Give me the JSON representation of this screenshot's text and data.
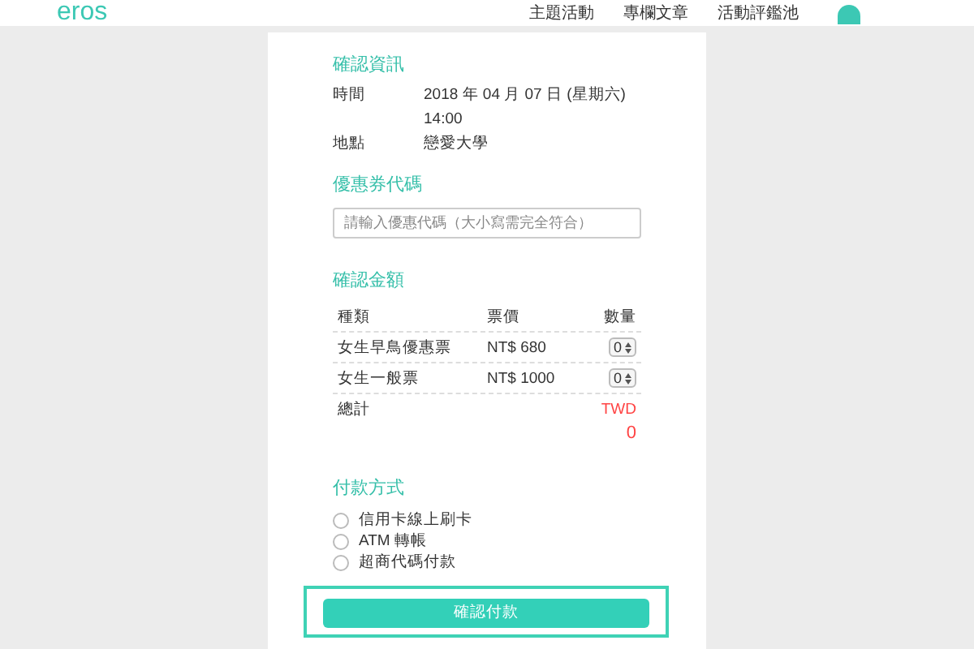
{
  "header": {
    "logo": "eros",
    "nav": [
      "主題活動",
      "專欄文章",
      "活動評鑑池"
    ]
  },
  "info": {
    "title": "確認資訊",
    "rows": [
      {
        "label": "時間",
        "values": [
          "2018 年 04 月 07 日 (星期六)",
          "14:00"
        ]
      },
      {
        "label": "地點",
        "values": [
          "戀愛大學"
        ]
      }
    ]
  },
  "coupon": {
    "title": "優惠券代碼",
    "placeholder": "請輸入優惠代碼（大小寫需完全符合）"
  },
  "amount": {
    "title": "確認金額",
    "columns": [
      "種類",
      "票價",
      "數量"
    ],
    "rows": [
      {
        "type": "女生早鳥優惠票",
        "price": "NT$ 680",
        "qty": "0"
      },
      {
        "type": "女生一般票",
        "price": "NT$ 1000",
        "qty": "0"
      }
    ],
    "total_label": "總計",
    "currency": "TWD",
    "total": "0"
  },
  "payment": {
    "title": "付款方式",
    "options": [
      {
        "label": "信用卡線上刷卡",
        "selected": false
      },
      {
        "label": "ATM 轉帳",
        "selected": false
      },
      {
        "label": "超商代碼付款",
        "selected": false
      }
    ]
  },
  "submit": "確認付款"
}
